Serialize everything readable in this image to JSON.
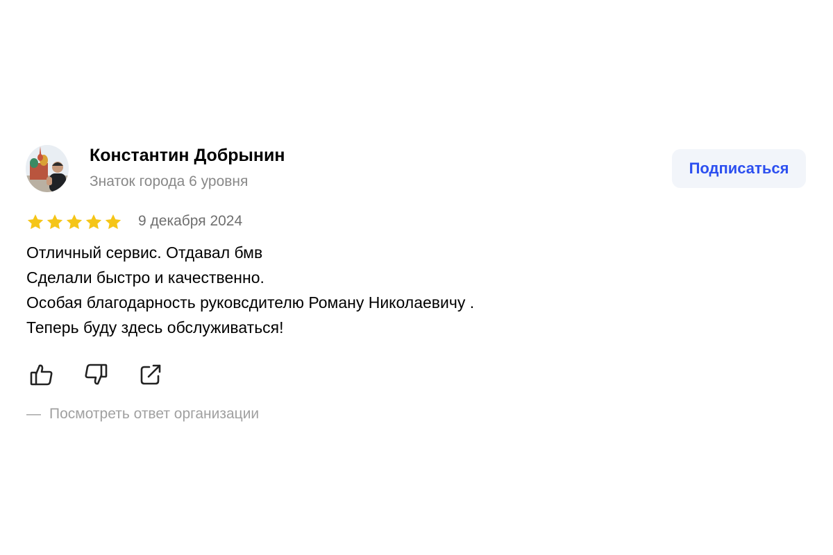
{
  "author": {
    "name": "Константин Добрынин",
    "level": "Знаток города 6 уровня",
    "avatar_icon": "user-avatar-photo"
  },
  "subscribe": {
    "label": "Подписаться"
  },
  "review": {
    "rating": 5,
    "rating_max": 5,
    "date": "9 декабря 2024",
    "lines": [
      "Отличный сервис. Отдавал бмв",
      "Сделали быстро и качественно.",
      "Особая благодарность руковсдителю Роману Николаевичу .",
      "Теперь буду здесь обслуживаться!"
    ]
  },
  "actions": {
    "like_icon": "thumbs-up-icon",
    "dislike_icon": "thumbs-down-icon",
    "share_icon": "share-icon"
  },
  "org_reply": {
    "dash": "—",
    "label": "Посмотреть ответ организации"
  },
  "colors": {
    "star": "#f5c518",
    "accent": "#2c4ff0",
    "button_bg": "#f2f5fa",
    "muted_text": "#888888",
    "date_text": "#6f6f6f",
    "reply_text": "#a0a0a0"
  }
}
